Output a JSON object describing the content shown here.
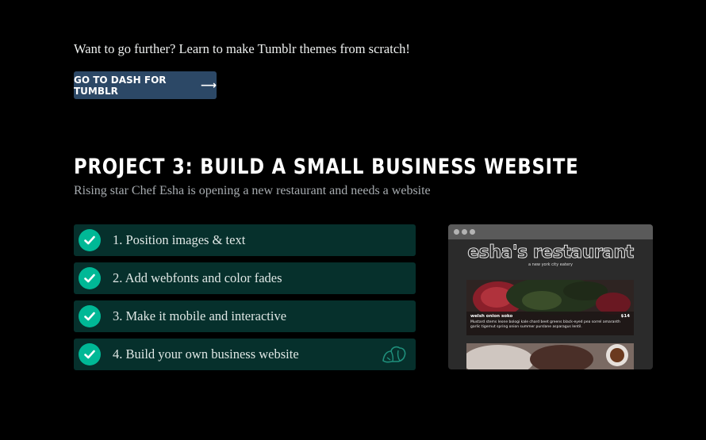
{
  "intro_text": "Want to go further? Learn to make Tumblr themes from scratch!",
  "dash_button": {
    "label": "Go to Dash for Tumblr",
    "arrow": "⟶"
  },
  "project": {
    "title": "PROJECT 3: BUILD A SMALL BUSINESS WEBSITE",
    "subtitle": "Rising star Chef Esha is opening a new restaurant and needs a website"
  },
  "steps": [
    {
      "label": "1. Position images & text",
      "completed": true
    },
    {
      "label": "2. Add webfonts and color fades",
      "completed": true
    },
    {
      "label": "3. Make it mobile and interactive",
      "completed": true
    },
    {
      "label": "4. Build your own business website",
      "completed": true,
      "icon": "chef-hat-icon"
    }
  ],
  "preview": {
    "site_title": "esha's restaurant",
    "tagline": "a new york city eatery",
    "dish": {
      "name": "welsh onion soko",
      "price": "$14",
      "description": "Mustard stems leone bologi kale chard beet greens black-eyed pea sorrel amaranth garlic tigernut spring onion summer purslane asparagus lentil."
    }
  },
  "colors": {
    "background": "#000000",
    "button": "#2c4866",
    "step_row": "#06302c",
    "check": "#00b896"
  }
}
